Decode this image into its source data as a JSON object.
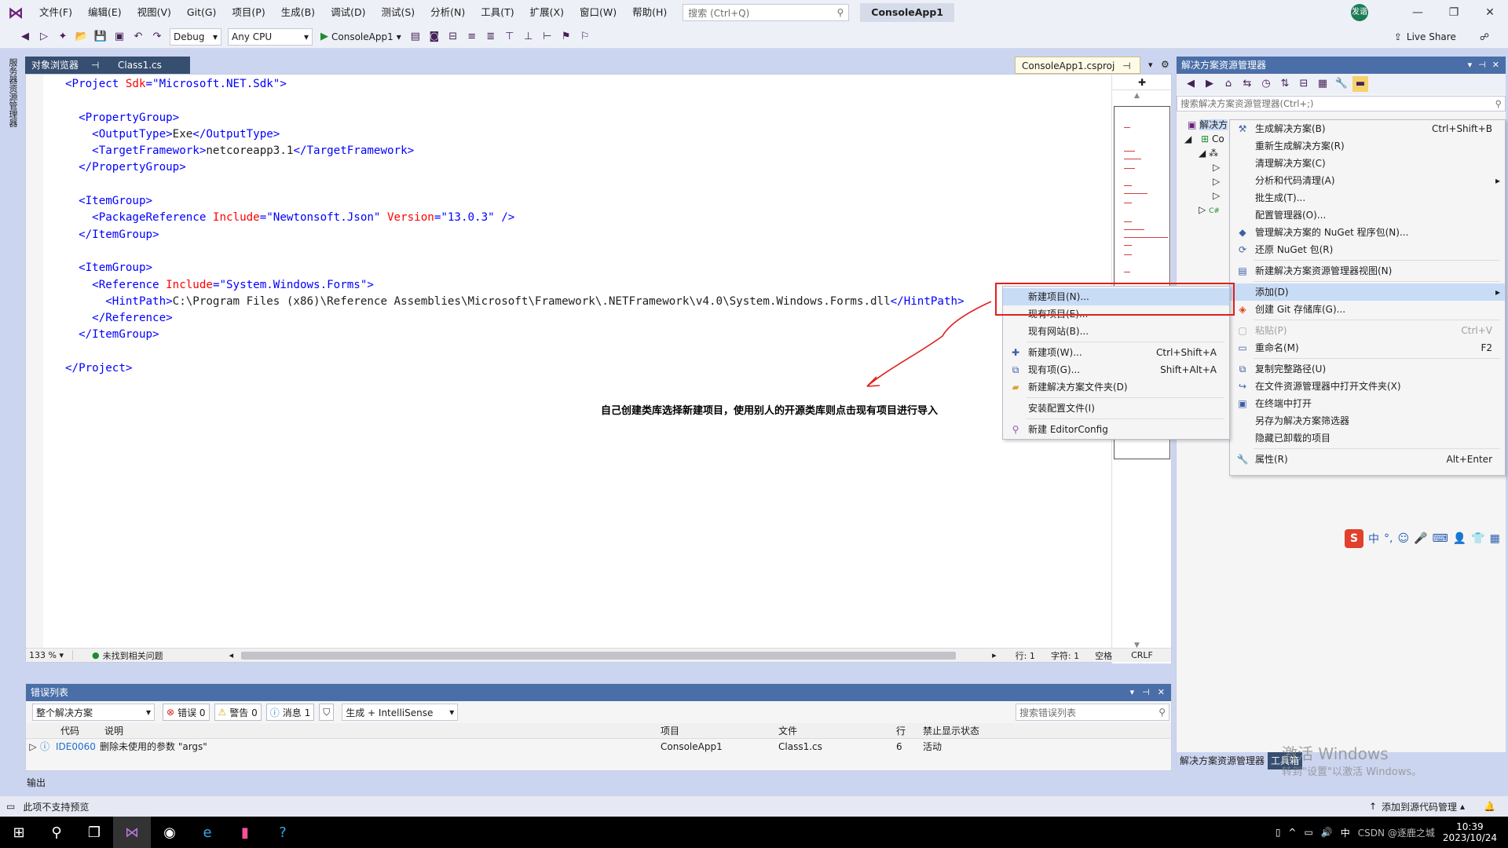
{
  "menubar": {
    "items": [
      "文件(F)",
      "编辑(E)",
      "视图(V)",
      "Git(G)",
      "项目(P)",
      "生成(B)",
      "调试(D)",
      "测试(S)",
      "分析(N)",
      "工具(T)",
      "扩展(X)",
      "窗口(W)",
      "帮助(H)"
    ],
    "search_placeholder": "搜索 (Ctrl+Q)",
    "project_title": "ConsoleApp1",
    "avatar_initials": "发谐"
  },
  "toolbar": {
    "config": "Debug",
    "platform": "Any CPU",
    "run_target": "ConsoleApp1",
    "live_share": "Live Share"
  },
  "left_rail": {
    "vertical_tab": "服务器资源管理器"
  },
  "doc_tabs": {
    "object_browser": "对象浏览器",
    "class1": "Class1.cs",
    "csproj": "ConsoleApp1.csproj"
  },
  "editor": {
    "zoom": "133 %",
    "issues": "未找到相关问题",
    "line": "行: 1",
    "char": "字符: 1",
    "spaces": "空格",
    "eol": "CRLF",
    "code": {
      "l1a": "<Project ",
      "l1b": "Sdk",
      "l1c": "=\"Microsoft.NET.Sdk\">",
      "pg_open": "<PropertyGroup>",
      "ot_open": "<OutputType>",
      "ot_val": "Exe",
      "ot_close": "</OutputType>",
      "tf_open": "<TargetFramework>",
      "tf_val": "netcoreapp3.1",
      "tf_close": "</TargetFramework>",
      "pg_close": "</PropertyGroup>",
      "ig_open": "<ItemGroup>",
      "pr_a": "<PackageReference ",
      "pr_b": "Include",
      "pr_c": "=\"Newtonsoft.Json\" ",
      "pr_d": "Version",
      "pr_e": "=\"13.0.3\" />",
      "ig_close": "</ItemGroup>",
      "ref_a": "<Reference ",
      "ref_b": "Include",
      "ref_c": "=\"System.Windows.Forms\">",
      "hp_open": "<HintPath>",
      "hp_val": "C:\\Program Files (x86)\\Reference Assemblies\\Microsoft\\Framework\\.NETFramework\\v4.0\\System.Windows.Forms.dll",
      "hp_close": "</HintPath>",
      "ref_close": "</Reference>",
      "proj_close": "</Project>"
    }
  },
  "annotation": "自己创建类库选择新建项目，使用别人的开源类库则点击现有项目进行导入",
  "solution_explorer": {
    "title": "解决方案资源管理器",
    "search_placeholder": "搜索解决方案资源管理器(Ctrl+;)",
    "tree_root": "解决方",
    "tree_child": "Co",
    "bottom_tab_1": "解决方案资源管理器",
    "bottom_tab_2": "工具箱"
  },
  "context_menu": [
    {
      "label": "生成解决方案(B)",
      "shortcut": "Ctrl+Shift+B",
      "icon": "build-icon"
    },
    {
      "label": "重新生成解决方案(R)",
      "shortcut": ""
    },
    {
      "label": "清理解决方案(C)",
      "shortcut": ""
    },
    {
      "label": "分析和代码清理(A)",
      "shortcut": "",
      "submenu": true
    },
    {
      "label": "批生成(T)...",
      "shortcut": ""
    },
    {
      "label": "配置管理器(O)...",
      "shortcut": ""
    },
    {
      "label": "管理解决方案的 NuGet 程序包(N)...",
      "shortcut": "",
      "icon": "nuget-icon"
    },
    {
      "label": "还原 NuGet 包(R)",
      "shortcut": "",
      "icon": "restore-icon"
    },
    {
      "label": "新建解决方案资源管理器视图(N)",
      "shortcut": "",
      "icon": "view-icon"
    },
    {
      "label": "添加(D)",
      "shortcut": "",
      "submenu": true
    },
    {
      "label": "创建 Git 存储库(G)...",
      "shortcut": "",
      "icon": "git-icon"
    },
    {
      "label": "粘贴(P)",
      "shortcut": "Ctrl+V",
      "disabled": true
    },
    {
      "label": "重命名(M)",
      "shortcut": "F2",
      "icon": "rename-icon"
    },
    {
      "label": "复制完整路径(U)",
      "shortcut": "",
      "icon": "copy-icon"
    },
    {
      "label": "在文件资源管理器中打开文件夹(X)",
      "shortcut": "",
      "icon": "folder-open-icon"
    },
    {
      "label": "在终端中打开",
      "shortcut": "",
      "icon": "terminal-icon"
    },
    {
      "label": "另存为解决方案筛选器",
      "shortcut": ""
    },
    {
      "label": "隐藏已卸载的项目",
      "shortcut": ""
    },
    {
      "label": "属性(R)",
      "shortcut": "Alt+Enter",
      "icon": "wrench-icon"
    }
  ],
  "add_submenu": [
    {
      "label": "新建项目(N)...",
      "shortcut": ""
    },
    {
      "label": "现有项目(E)...",
      "shortcut": ""
    },
    {
      "label": "现有网站(B)...",
      "shortcut": ""
    },
    {
      "label": "新建项(W)...",
      "shortcut": "Ctrl+Shift+A",
      "icon": "new-item-icon"
    },
    {
      "label": "现有项(G)...",
      "shortcut": "Shift+Alt+A",
      "icon": "existing-item-icon"
    },
    {
      "label": "新建解决方案文件夹(D)",
      "shortcut": "",
      "icon": "folder-icon"
    },
    {
      "label": "安装配置文件(I)",
      "shortcut": ""
    },
    {
      "label": "新建 EditorConfig",
      "shortcut": "",
      "icon": "editorconfig-icon"
    }
  ],
  "error_list": {
    "title": "错误列表",
    "scope": "整个解决方案",
    "errors": "错误 0",
    "warnings": "警告 0",
    "messages": "消息 1",
    "build_filter": "生成 + IntelliSense",
    "search_placeholder": "搜索错误列表",
    "columns": [
      "代码",
      "说明",
      "项目",
      "文件",
      "行",
      "禁止显示状态"
    ],
    "rows": [
      {
        "code": "IDE0060",
        "desc": "删除未使用的参数 \"args\"",
        "project": "ConsoleApp1",
        "file": "Class1.cs",
        "line": "6",
        "state": "活动"
      }
    ]
  },
  "output_tab": "输出",
  "statusbar": {
    "left": "此项不支持预览",
    "right": "添加到源代码管理"
  },
  "taskbar": {
    "time": "10:39",
    "date": "2023/10/24",
    "ime": "中",
    "csdn": "CSDN @逐鹿之城"
  },
  "watermark": {
    "line1": "激活 Windows",
    "line2": "转到\"设置\"以激活 Windows。"
  },
  "colors": {
    "accent": "#4a6ea8",
    "highlight_box": "#e0201c",
    "arrow": "#e0201c"
  }
}
